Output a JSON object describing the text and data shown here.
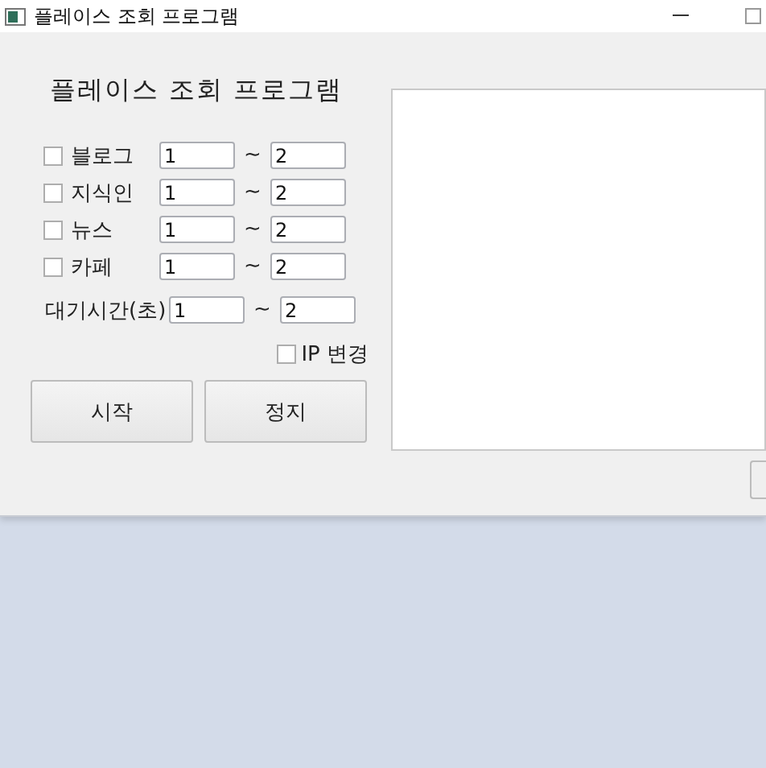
{
  "window": {
    "title": "플레이스 조회 프로그램"
  },
  "heading": "플레이스 조회 프로그램",
  "sources": [
    {
      "label": "블로그",
      "checked": false,
      "from": "1",
      "separator": "~",
      "to": "2"
    },
    {
      "label": "지식인",
      "checked": false,
      "from": "1",
      "separator": "~",
      "to": "2"
    },
    {
      "label": "뉴스",
      "checked": false,
      "from": "1",
      "separator": "~",
      "to": "2"
    },
    {
      "label": "카페",
      "checked": false,
      "from": "1",
      "separator": "~",
      "to": "2"
    }
  ],
  "wait": {
    "label": "대기시간(초)",
    "from": "1",
    "separator": "~",
    "to": "2"
  },
  "ip_change": {
    "label": "IP 변경",
    "checked": false
  },
  "buttons": [
    "시작",
    "정지"
  ]
}
